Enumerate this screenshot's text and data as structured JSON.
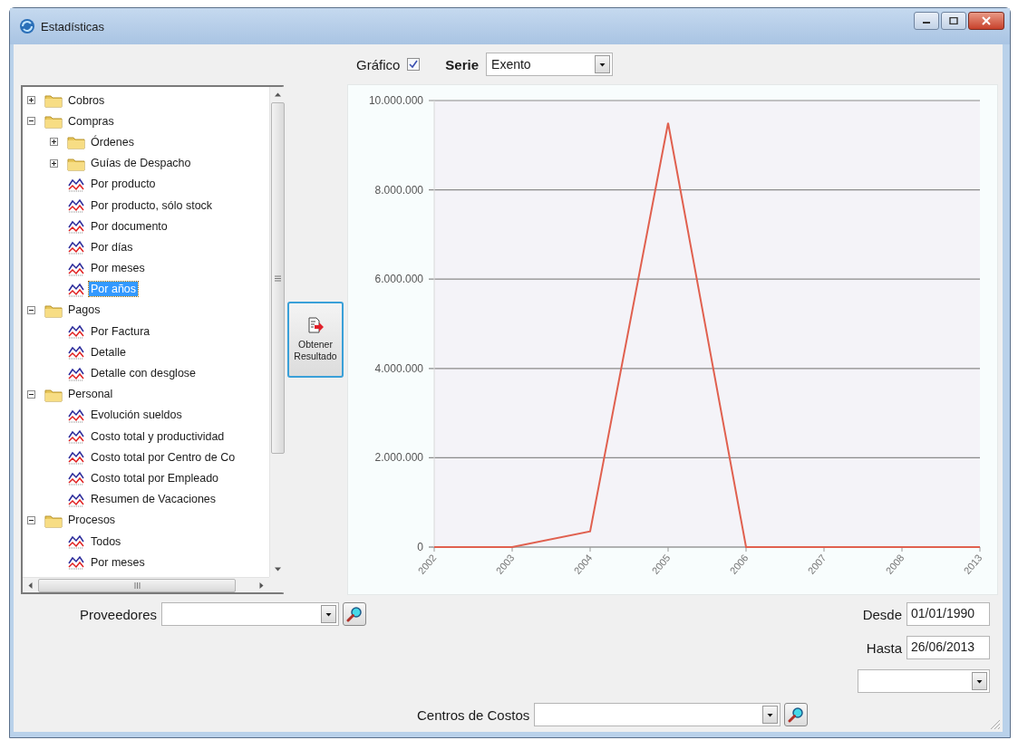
{
  "window": {
    "title": "Estadísticas"
  },
  "toolbar": {
    "chart_toggle": {
      "label": "Gráfico",
      "checked": true
    },
    "series_select": {
      "label": "Serie",
      "value": "Exento"
    }
  },
  "tree": [
    {
      "label": "Cobros",
      "kind": "folder",
      "expanded": false,
      "selected": false
    },
    {
      "label": "Compras",
      "kind": "folder",
      "expanded": true,
      "selected": false,
      "children": [
        {
          "label": "Órdenes",
          "kind": "folder",
          "expanded": false,
          "selected": false
        },
        {
          "label": "Guías de Despacho",
          "kind": "folder",
          "expanded": false,
          "selected": false
        },
        {
          "label": "Por producto",
          "kind": "report",
          "selected": false
        },
        {
          "label": "Por producto, sólo stock",
          "kind": "report",
          "selected": false
        },
        {
          "label": "Por documento",
          "kind": "report",
          "selected": false
        },
        {
          "label": "Por días",
          "kind": "report",
          "selected": false
        },
        {
          "label": "Por meses",
          "kind": "report",
          "selected": false
        },
        {
          "label": "Por años",
          "kind": "report",
          "selected": true
        }
      ]
    },
    {
      "label": "Pagos",
      "kind": "folder",
      "expanded": true,
      "selected": false,
      "children": [
        {
          "label": "Por Factura",
          "kind": "report",
          "selected": false
        },
        {
          "label": "Detalle",
          "kind": "report",
          "selected": false
        },
        {
          "label": "Detalle con desglose",
          "kind": "report",
          "selected": false
        }
      ]
    },
    {
      "label": "Personal",
      "kind": "folder",
      "expanded": true,
      "selected": false,
      "children": [
        {
          "label": "Evolución sueldos",
          "kind": "report",
          "selected": false
        },
        {
          "label": "Costo total y productividad",
          "kind": "report",
          "selected": false
        },
        {
          "label": "Costo total por Centro de Co",
          "kind": "report",
          "selected": false
        },
        {
          "label": "Costo total por Empleado",
          "kind": "report",
          "selected": false
        },
        {
          "label": "Resumen de Vacaciones",
          "kind": "report",
          "selected": false
        }
      ]
    },
    {
      "label": "Procesos",
      "kind": "folder",
      "expanded": true,
      "selected": false,
      "children": [
        {
          "label": "Todos",
          "kind": "report",
          "selected": false
        },
        {
          "label": "Por meses",
          "kind": "report",
          "selected": false
        }
      ]
    }
  ],
  "action_button": {
    "label": "Obtener Resultado"
  },
  "chart_data": {
    "type": "line",
    "categories": [
      "2002",
      "2003",
      "2004",
      "2005",
      "2006",
      "2007",
      "2008",
      "2013"
    ],
    "grid": true,
    "series": [
      {
        "color": "#e0604f",
        "values": [
          0,
          0,
          350000,
          9500000,
          0,
          0,
          0,
          0
        ]
      }
    ],
    "ylim": [
      0,
      10000000
    ],
    "yticks": [
      {
        "value": 0,
        "label": "0"
      },
      {
        "value": 2000000,
        "label": "2.000.000"
      },
      {
        "value": 4000000,
        "label": "4.000.000"
      },
      {
        "value": 6000000,
        "label": "6.000.000"
      },
      {
        "value": 8000000,
        "label": "8.000.000"
      },
      {
        "value": 10000000,
        "label": "10.000.000"
      }
    ]
  },
  "filters": {
    "proveedores": {
      "label": "Proveedores"
    },
    "date_from": {
      "label": "Desde",
      "value": "01/01/1990"
    },
    "date_to": {
      "label": "Hasta",
      "value": "26/06/2013"
    },
    "cost_centers": {
      "label": "Centros de Costos"
    }
  }
}
